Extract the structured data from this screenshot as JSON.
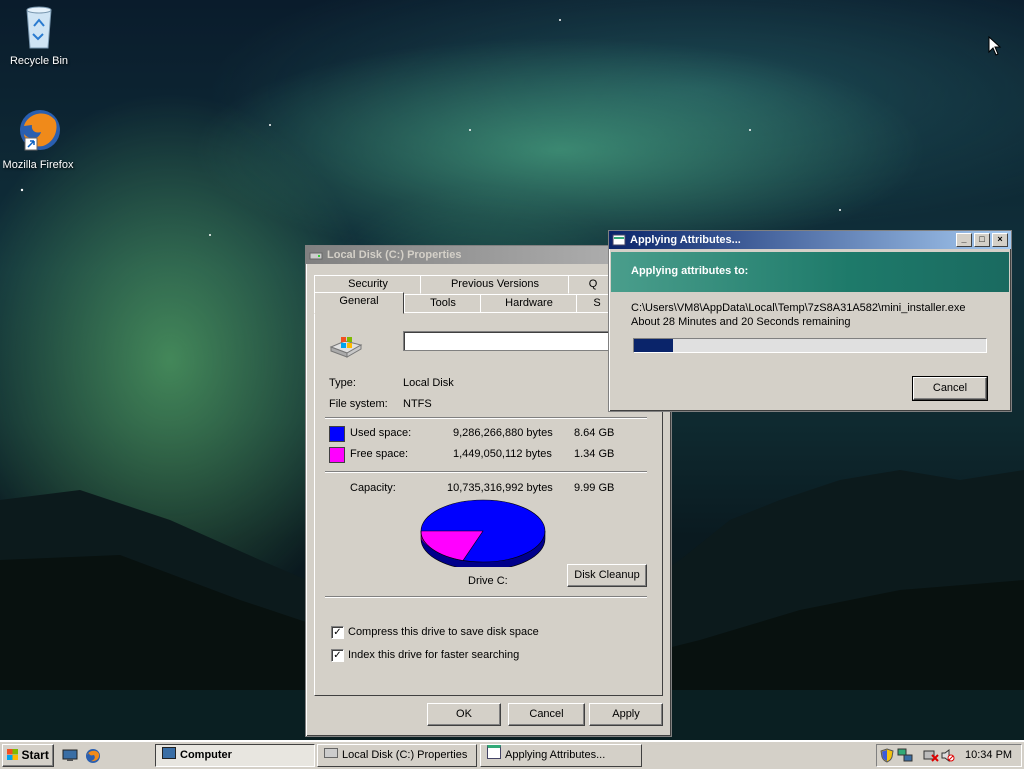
{
  "desktop": {
    "icons": [
      {
        "label": "Recycle Bin",
        "icon": "recycle-bin-icon"
      },
      {
        "label": "Mozilla Firefox",
        "icon": "firefox-icon"
      }
    ]
  },
  "properties_window": {
    "title": "Local Disk (C:) Properties",
    "tabs_row1": [
      "Security",
      "Previous Versions",
      "Q"
    ],
    "tabs_row2": [
      "General",
      "Tools",
      "Hardware",
      "S"
    ],
    "selected_tab": "General",
    "drive_label_value": "",
    "type_label": "Type:",
    "type_value": "Local Disk",
    "fs_label": "File system:",
    "fs_value": "NTFS",
    "used_label": "Used space:",
    "used_bytes": "9,286,266,880 bytes",
    "used_gb": "8.64 GB",
    "free_label": "Free space:",
    "free_bytes": "1,449,050,112 bytes",
    "free_gb": "1.34 GB",
    "capacity_label": "Capacity:",
    "capacity_bytes": "10,735,316,992 bytes",
    "capacity_gb": "9.99 GB",
    "drive_caption": "Drive C:",
    "disk_cleanup": "Disk Cleanup",
    "compress_label": "Compress this drive to save disk space",
    "compress_checked": true,
    "index_label": "Index this drive for faster searching",
    "index_checked": true,
    "ok": "OK",
    "cancel": "Cancel",
    "apply": "Apply",
    "used_color": "#0000ff",
    "free_color": "#ff00ff"
  },
  "attributes_dialog": {
    "title": "Applying Attributes...",
    "heading": "Applying attributes to:",
    "path": "C:\\Users\\VM8\\AppData\\Local\\Temp\\7zS8A31A582\\mini_installer.exe",
    "time_remaining": "About 28 Minutes and 20 Seconds remaining",
    "progress": 0.11,
    "cancel": "Cancel",
    "header_color": "#1e7a6a"
  },
  "taskbar": {
    "start": "Start",
    "items": [
      "Computer",
      "Local Disk (C:) Properties",
      "Applying Attributes..."
    ],
    "clock": "10:34 PM"
  }
}
